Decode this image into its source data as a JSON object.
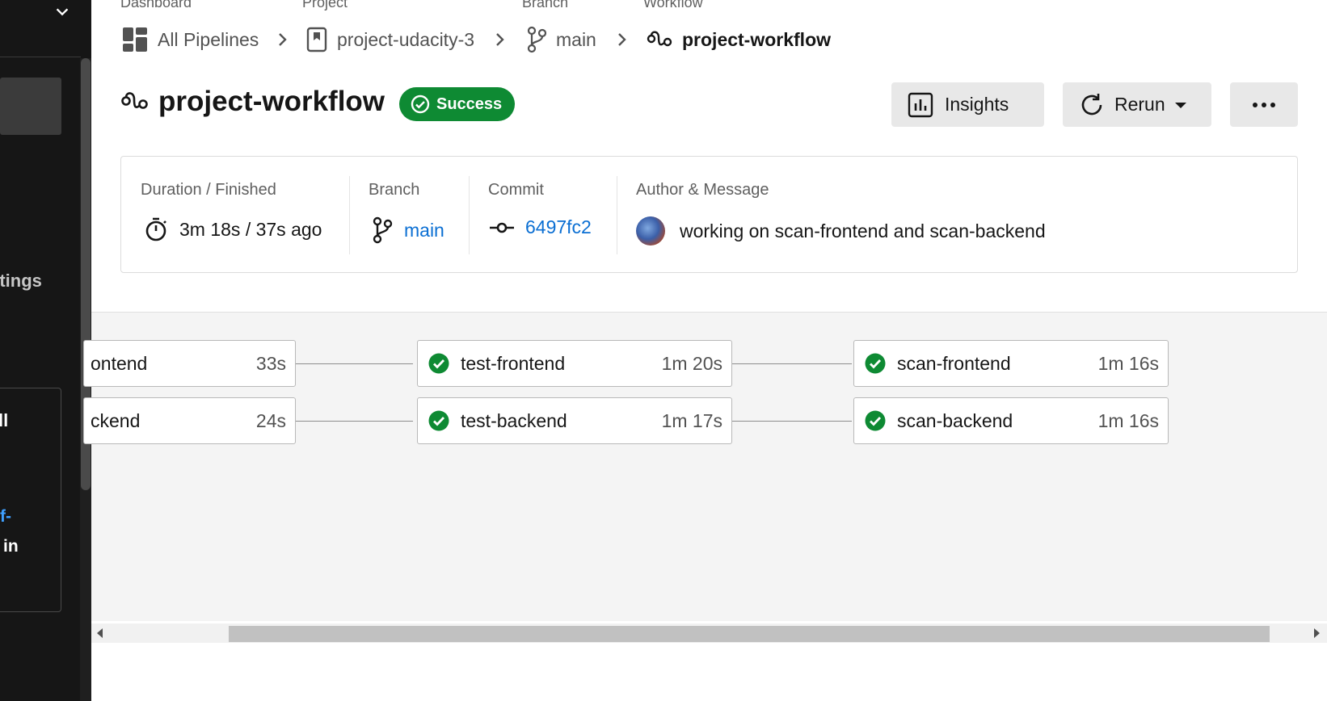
{
  "sidebar": {
    "settings_label": "ttings",
    "card_title": "ll",
    "card_link": "f-",
    "card_text": "in"
  },
  "breadcrumbs": [
    {
      "label": "Dashboard",
      "value": "All Pipelines",
      "icon": "dashboard-icon"
    },
    {
      "label": "Project",
      "value": "project-udacity-3",
      "icon": "bookmark-icon"
    },
    {
      "label": "Branch",
      "value": "main",
      "icon": "branch-icon"
    },
    {
      "label": "Workflow",
      "value": "project-workflow",
      "icon": "workflow-icon"
    }
  ],
  "header": {
    "title": "project-workflow",
    "status": "Success",
    "status_color": "#0e8a33",
    "insights_label": "Insights",
    "rerun_label": "Rerun"
  },
  "info": {
    "duration_label": "Duration / Finished",
    "duration_value": "3m 18s / 37s ago",
    "branch_label": "Branch",
    "branch_value": "main",
    "commit_label": "Commit",
    "commit_value": "6497fc2",
    "author_label": "Author & Message",
    "message": "working on scan-frontend and scan-backend",
    "link_color": "#0b6fd3"
  },
  "jobs": [
    {
      "name": "ontend",
      "duration": "33s",
      "status": "success"
    },
    {
      "name": "ckend",
      "duration": "24s",
      "status": "success"
    },
    {
      "name": "test-frontend",
      "duration": "1m 20s",
      "status": "success"
    },
    {
      "name": "test-backend",
      "duration": "1m 17s",
      "status": "success"
    },
    {
      "name": "scan-frontend",
      "duration": "1m 16s",
      "status": "success"
    },
    {
      "name": "scan-backend",
      "duration": "1m 16s",
      "status": "success"
    }
  ]
}
